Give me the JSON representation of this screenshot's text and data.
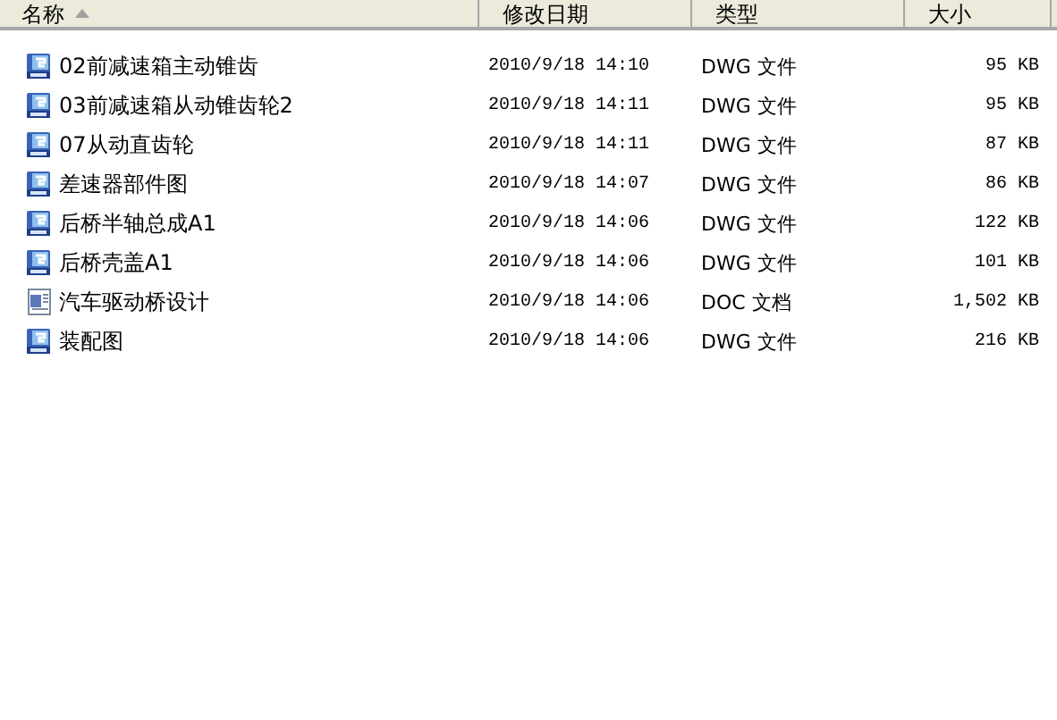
{
  "columns": [
    {
      "label": "名称",
      "sorted": true
    },
    {
      "label": "修改日期",
      "sorted": false
    },
    {
      "label": "类型",
      "sorted": false
    },
    {
      "label": "大小",
      "sorted": false
    }
  ],
  "files": [
    {
      "kind": "dwg",
      "name": "02前减速箱主动锥齿",
      "modified": "2010/9/18 14:10",
      "type": "DWG 文件",
      "size": "95 KB"
    },
    {
      "kind": "dwg",
      "name": "03前减速箱从动锥齿轮2",
      "modified": "2010/9/18 14:11",
      "type": "DWG 文件",
      "size": "95 KB"
    },
    {
      "kind": "dwg",
      "name": "07从动直齿轮",
      "modified": "2010/9/18 14:11",
      "type": "DWG 文件",
      "size": "87 KB"
    },
    {
      "kind": "dwg",
      "name": "差速器部件图",
      "modified": "2010/9/18 14:07",
      "type": "DWG 文件",
      "size": "86 KB"
    },
    {
      "kind": "dwg",
      "name": "后桥半轴总成A1",
      "modified": "2010/9/18 14:06",
      "type": "DWG 文件",
      "size": "122 KB"
    },
    {
      "kind": "dwg",
      "name": "后桥壳盖A1",
      "modified": "2010/9/18 14:06",
      "type": "DWG 文件",
      "size": "101 KB"
    },
    {
      "kind": "doc",
      "name": "汽车驱动桥设计",
      "modified": "2010/9/18 14:06",
      "type": "DOC 文档",
      "size": "1,502 KB"
    },
    {
      "kind": "dwg",
      "name": "装配图",
      "modified": "2010/9/18 14:06",
      "type": "DWG 文件",
      "size": "216 KB"
    }
  ]
}
